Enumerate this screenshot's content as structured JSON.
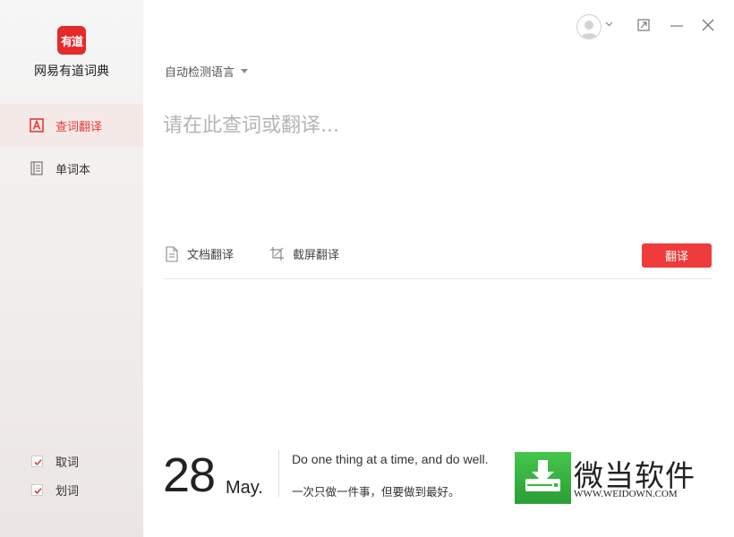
{
  "app": {
    "logo_text": "有道",
    "name": "网易有道词典"
  },
  "sidebar": {
    "items": [
      {
        "label": "查词翻译",
        "icon": "translate-a-icon",
        "active": true
      },
      {
        "label": "单词本",
        "icon": "notebook-icon",
        "active": false
      }
    ],
    "options": [
      {
        "label": "取词",
        "checked": true
      },
      {
        "label": "划词",
        "checked": true
      }
    ]
  },
  "window": {
    "controls": [
      "avatar-icon",
      "restore-icon",
      "minimize-icon",
      "close-icon"
    ]
  },
  "translate": {
    "language": "自动检测语言",
    "placeholder": "请在此查词或翻译...",
    "doc_translate": "文档翻译",
    "screenshot_translate": "截屏翻译",
    "button": "翻译"
  },
  "daily": {
    "day": "28",
    "month": "May.",
    "sentence_en": "Do one thing at a time, and do well.",
    "sentence_cn": "一次只做一件事，但要做到最好。"
  },
  "watermark": {
    "name": "微当软件",
    "url": "WWW.WEIDOWN.COM"
  },
  "colors": {
    "accent": "#ef3b3b",
    "active_bg": "#f5e9e7",
    "watermark_green": "#3bb644"
  }
}
